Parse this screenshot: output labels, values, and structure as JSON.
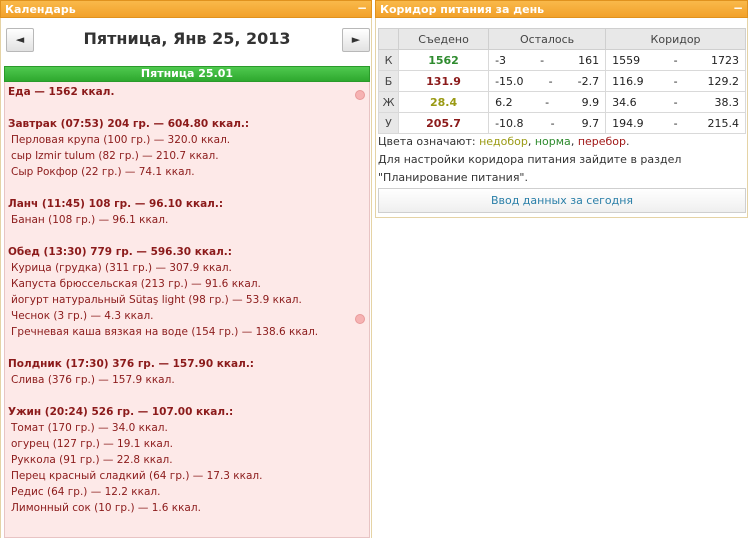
{
  "calendar": {
    "header_title": "Календарь",
    "minimize_glyph": "−",
    "prev_glyph": "◄",
    "next_glyph": "►",
    "date_title": "Пятница, Янв 25, 2013",
    "day_bar": "Пятница 25.01",
    "total_line": "Еда — 1562 ккал.",
    "meals": [
      {
        "title": "Завтрак (07:53) 204 гр. — 604.80 ккал.:",
        "items": [
          "Перловая крупа (100 гр.) — 320.0 ккал.",
          "сыр Izmir tulum (82 гр.) — 210.7 ккал.",
          "Сыр Рокфор (22 гр.) — 74.1 ккал."
        ]
      },
      {
        "title": "Ланч (11:45) 108 гр. — 96.10 ккал.:",
        "items": [
          "Банан (108 гр.) — 96.1 ккал."
        ]
      },
      {
        "title": "Обед (13:30) 779 гр. — 596.30 ккал.:",
        "items": [
          "Курица (грудка) (311 гр.) — 307.9 ккал.",
          "Капуста брюссельская (213 гр.) — 91.6 ккал.",
          "йогурт натуральный Sütaş light (98 гр.) — 53.9 ккал.",
          "Чеснок (3 гр.) — 4.3 ккал.",
          "Гречневая каша вязкая на воде (154 гр.) — 138.6 ккал."
        ]
      },
      {
        "title": "Полдник (17:30) 376 гр. — 157.90 ккал.:",
        "items": [
          "Слива (376 гр.) — 157.9 ккал."
        ]
      },
      {
        "title": "Ужин (20:24) 526 гр. — 107.00 ккал.:",
        "items": [
          "Томат (170 гр.) — 34.0 ккал.",
          "огурец (127 гр.) — 19.1 ккал.",
          "Руккола (91 гр.) — 22.8 ккал.",
          "Перец красный сладкий (64 гр.) — 17.3 ккал.",
          "Редис (64 гр.) — 12.2 ккал.",
          "Лимонный сок (10 гр.) — 1.6 ккал."
        ]
      }
    ]
  },
  "corridor": {
    "header_title": "Коридор питания за день",
    "minimize_glyph": "−",
    "columns": [
      "Съедено",
      "Осталось",
      "Коридор"
    ],
    "rows": [
      {
        "label": "К",
        "eaten": "1562",
        "eaten_color": "green",
        "left_min": "-3",
        "left_max": "161",
        "corr_min": "1559",
        "corr_max": "1723"
      },
      {
        "label": "Б",
        "eaten": "131.9",
        "eaten_color": "dark",
        "left_min": "-15.0",
        "left_max": "-2.7",
        "corr_min": "116.9",
        "corr_max": "129.2"
      },
      {
        "label": "Ж",
        "eaten": "28.4",
        "eaten_color": "olive",
        "left_min": "6.2",
        "left_max": "9.9",
        "corr_min": "34.6",
        "corr_max": "38.3"
      },
      {
        "label": "У",
        "eaten": "205.7",
        "eaten_color": "dark",
        "left_min": "-10.8",
        "left_max": "9.7",
        "corr_min": "194.9",
        "corr_max": "215.4"
      }
    ],
    "dash": "-",
    "legend_prefix": "Цвета означают:",
    "legend_under": "недобор",
    "legend_norm": "норма",
    "legend_over": "перебор",
    "legend_comma": ",",
    "legend_dot": ".",
    "hint_line1": "Для настройки коридора питания зайдите в раздел",
    "hint_line2": "\"Планирование питания\".",
    "enter_button": "Ввод данных за сегодня"
  },
  "colors": {
    "header_orange": "#f2a12a",
    "day_bar_green": "#2ea82e",
    "day_body_pink": "#fde9e8",
    "text_dark_red": "#8b1a1a",
    "under_olive": "#9a9a14",
    "norm_green": "#2e8b2e",
    "over_red": "#a01818",
    "link_blue": "#2a7fa8"
  }
}
